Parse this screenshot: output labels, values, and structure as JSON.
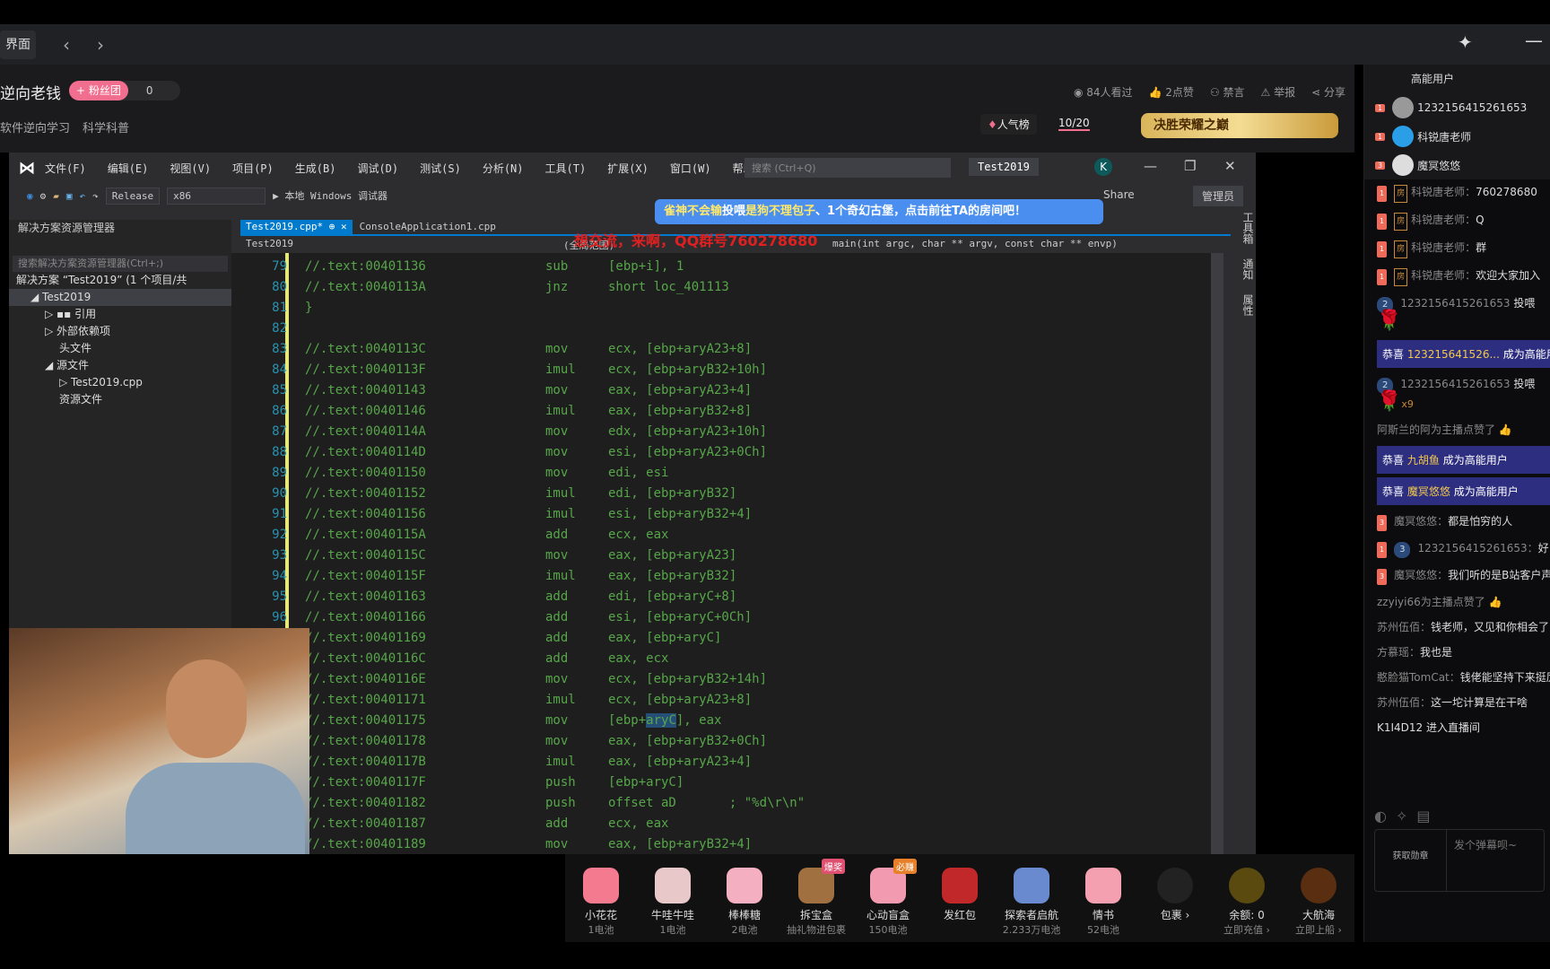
{
  "nav": {
    "tab": "界面",
    "back": "‹",
    "forward": "›"
  },
  "stream": {
    "title": "逆向老钱",
    "fan_button": "+ 粉丝团",
    "fan_count": "0",
    "tags": [
      "软件逆向学习",
      "科学科普"
    ],
    "stats": [
      "84人看过",
      "2点赞",
      "禁言",
      "举报",
      "分享"
    ],
    "rank": "人气榜",
    "count": "10/20",
    "banner": "决胜荣耀之巅"
  },
  "vs": {
    "menu": [
      "文件(F)",
      "编辑(E)",
      "视图(V)",
      "项目(P)",
      "生成(B)",
      "调试(D)",
      "测试(S)",
      "分析(N)",
      "工具(T)",
      "扩展(X)",
      "窗口(W)",
      "帮助(H)"
    ],
    "search_placeholder": "搜索 (Ctrl+Q)",
    "title": "Test2019",
    "avatar": "K",
    "config": "Release",
    "platform": "x86",
    "run": "▶ 本地 Windows 调试器",
    "share": "Share",
    "admin": "管理员",
    "solution_explorer": {
      "title": "解决方案资源管理器",
      "search_placeholder": "搜索解决方案资源管理器(Ctrl+;)",
      "tree": [
        {
          "label": "解决方案 “Test2019” (1 个项目/共",
          "indent": 0
        },
        {
          "label": "◢ Test2019",
          "indent": 1,
          "selected": true
        },
        {
          "label": "▷ ▪▪ 引用",
          "indent": 2
        },
        {
          "label": "▷ 外部依赖项",
          "indent": 2
        },
        {
          "label": "头文件",
          "indent": 3
        },
        {
          "label": "◢ 源文件",
          "indent": 2
        },
        {
          "label": "▷ Test2019.cpp",
          "indent": 3
        },
        {
          "label": "资源文件",
          "indent": 3
        }
      ]
    },
    "tabs": [
      {
        "label": "Test2019.cpp*  ⊕ ✕"
      },
      {
        "label": "ConsoleApplication1.cpp"
      }
    ],
    "nav": {
      "project": "Test2019",
      "scope": "(全局范围)",
      "function": "main(int argc, char ** argv, const char ** envp)"
    },
    "vertical_tabs": [
      "工具箱",
      "通知",
      "属性"
    ],
    "code": [
      [
        "79",
        "//.text:00401136",
        "sub",
        "[ebp+i], 1"
      ],
      [
        "80",
        "//.text:0040113A",
        "jnz",
        "short loc_401113"
      ],
      [
        "81",
        "  }",
        "",
        ""
      ],
      [
        "82",
        "",
        "",
        ""
      ],
      [
        "83",
        "//.text:0040113C",
        "mov",
        "ecx, [ebp+aryA23+8]"
      ],
      [
        "84",
        "//.text:0040113F",
        "imul",
        "ecx, [ebp+aryB32+10h]"
      ],
      [
        "85",
        "//.text:00401143",
        "mov",
        "eax, [ebp+aryA23+4]"
      ],
      [
        "86",
        "//.text:00401146",
        "imul",
        "eax, [ebp+aryB32+8]"
      ],
      [
        "87",
        "//.text:0040114A",
        "mov",
        "edx, [ebp+aryA23+10h]"
      ],
      [
        "88",
        "//.text:0040114D",
        "mov",
        "esi, [ebp+aryA23+0Ch]"
      ],
      [
        "89",
        "//.text:00401150",
        "mov",
        "edi, esi"
      ],
      [
        "90",
        "//.text:00401152",
        "imul",
        "edi, [ebp+aryB32]"
      ],
      [
        "91",
        "//.text:00401156",
        "imul",
        "esi, [ebp+aryB32+4]"
      ],
      [
        "92",
        "//.text:0040115A",
        "add",
        "ecx, eax"
      ],
      [
        "93",
        "//.text:0040115C",
        "mov",
        "eax, [ebp+aryA23]"
      ],
      [
        "94",
        "//.text:0040115F",
        "imul",
        "eax, [ebp+aryB32]"
      ],
      [
        "95",
        "//.text:00401163",
        "add",
        "edi, [ebp+aryC+8]"
      ],
      [
        "96",
        "//.text:00401166",
        "add",
        "esi, [ebp+aryC+0Ch]"
      ],
      [
        "",
        "//.text:00401169",
        "add",
        "eax, [ebp+aryC]"
      ],
      [
        "",
        "//.text:0040116C",
        "add",
        "eax, ecx"
      ],
      [
        "",
        "//.text:0040116E",
        "mov",
        "ecx, [ebp+aryB32+14h]"
      ],
      [
        "",
        "//.text:00401171",
        "imul",
        "ecx, [ebp+aryA23+8]"
      ],
      [
        "",
        "//.text:00401175",
        "mov",
        "[ebp+aryC], eax"
      ],
      [
        "",
        "//.text:00401178",
        "mov",
        "eax, [ebp+aryB32+0Ch]"
      ],
      [
        "",
        "//.text:0040117B",
        "imul",
        "eax, [ebp+aryA23+4]"
      ],
      [
        "",
        "//.text:0040117F",
        "push",
        "[ebp+aryC]"
      ],
      [
        "",
        "//.text:00401182",
        "push",
        "offset aD       ; \"%d\\r\\n\""
      ],
      [
        "",
        "//.text:00401187",
        "add",
        "ecx, eax"
      ],
      [
        "",
        "//.text:00401189",
        "mov",
        "eax, [ebp+aryB32+4]"
      ]
    ]
  },
  "overlay": {
    "promo_a": "雀神不会输",
    "promo_b": "投喂",
    "promo_c": "是狗不理包子",
    "promo_d": "、1个奇幻古堡，点击前往TA的房间吧！",
    "qq": "想交流，来啊，QQ群号760278680"
  },
  "gifts": [
    {
      "name": "小花花",
      "price": "1电池",
      "color": "#f47a90"
    },
    {
      "name": "牛哇牛哇",
      "price": "1电池",
      "color": "#e8c8c8"
    },
    {
      "name": "棒棒糖",
      "price": "2电池",
      "color": "#f4b0c0"
    },
    {
      "name": "拆宝盒",
      "price": "抽礼物进包裹",
      "color": "#a07040",
      "badge": "爆奖",
      "badge_color": "#e05070"
    },
    {
      "name": "心动盲盒",
      "price": "150电池",
      "color": "#f29ab0",
      "badge": "必赚",
      "badge_color": "#e8802a"
    },
    {
      "name": "发红包",
      "price": "",
      "color": "#c0282a"
    },
    {
      "name": "探索者启航",
      "price": "2.233万电池",
      "color": "#6a8ad0"
    },
    {
      "name": "情书",
      "price": "52电池",
      "color": "#f4a0b0"
    },
    {
      "name": "包裹 ›",
      "price": "",
      "color": "#222"
    },
    {
      "name": "余额: 0",
      "price": "立即充值 ›",
      "color": "#5a4a10"
    },
    {
      "name": "大航海",
      "price": "立即上船 ›",
      "color": "#5a2e10"
    }
  ],
  "chat": {
    "header": "高能用户",
    "top_users": [
      {
        "level": "1",
        "name": "1232156415261653",
        "color": "#999"
      },
      {
        "level": "1",
        "name": "科锐唐老师",
        "color": "#2a9fe8"
      },
      {
        "level": "3",
        "name": "魔冥悠悠",
        "color": "#ddd"
      }
    ],
    "messages": [
      {
        "type": "msg",
        "level": "1",
        "room": "房",
        "user": "科锐唐老师：",
        "text": "760278680"
      },
      {
        "type": "msg",
        "level": "1",
        "room": "房",
        "user": "科锐唐老师：",
        "text": "Q"
      },
      {
        "type": "msg",
        "level": "1",
        "room": "房",
        "user": "科锐唐老师：",
        "text": "群"
      },
      {
        "type": "msg",
        "level": "1",
        "room": "房",
        "user": "科锐唐老师：",
        "text": "欢迎大家加入"
      },
      {
        "type": "gift",
        "vip": "2",
        "user": "1232156415261653",
        "text": "投喂",
        "qty": ""
      },
      {
        "type": "cong",
        "pre": "恭喜",
        "name": "123215641526...",
        "post": "成为高能用户"
      },
      {
        "type": "gift",
        "vip": "2",
        "user": "1232156415261653",
        "text": "投喂",
        "qty": "x9"
      },
      {
        "type": "like",
        "text": "阿斯兰的阿为主播点赞了"
      },
      {
        "type": "cong",
        "pre": "恭喜",
        "name": "九胡鱼",
        "post": "成为高能用户"
      },
      {
        "type": "cong",
        "pre": "恭喜",
        "name": "魔冥悠悠",
        "post": "成为高能用户"
      },
      {
        "type": "msg",
        "level": "3",
        "user": "魔冥悠悠：",
        "text": "都是怕穷的人"
      },
      {
        "type": "msg",
        "level": "1",
        "vip": "3",
        "user": "1232156415261653：",
        "text": "好"
      },
      {
        "type": "msg",
        "level": "3",
        "user": "魔冥悠悠：",
        "text": "我们听的是B站客户声音"
      },
      {
        "type": "like",
        "text": "zzyiyi66为主播点赞了"
      },
      {
        "type": "msg",
        "user": "苏州伍佰：",
        "text": "钱老师，又见和你相会了"
      },
      {
        "type": "msg",
        "user": "方慕瑶：",
        "text": "我也是"
      },
      {
        "type": "msg",
        "user": "憨脸猫TomCat：",
        "text": "钱佬能坚持下来挺厉"
      },
      {
        "type": "msg",
        "user": "苏州伍佰：",
        "text": "这一坨计算是在干啥"
      },
      {
        "type": "msg",
        "user": "",
        "text": "K1I4D12 进入直播间"
      }
    ],
    "medal": "获取勋章",
    "input_placeholder": "发个弹幕呗~"
  }
}
